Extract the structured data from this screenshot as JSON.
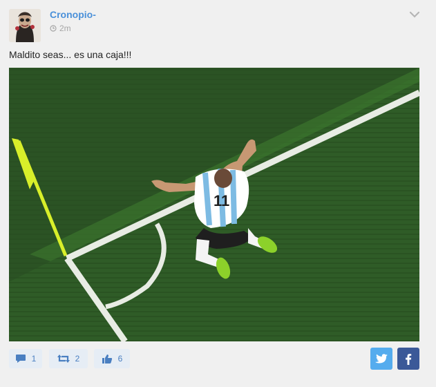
{
  "post": {
    "author": "Cronopio-",
    "time": "2m",
    "text": "Maldito seas... es una caja!!!",
    "player_number": "11"
  },
  "actions": {
    "comments": "1",
    "retweets": "2",
    "likes": "6"
  },
  "share": {
    "twitter_color": "#55acee",
    "facebook_color": "#3b5998"
  },
  "icons": {
    "time": "clock-icon",
    "menu": "chevron-down-icon",
    "comment": "comment-icon",
    "retweet": "retweet-icon",
    "like": "thumbs-up-icon",
    "twitter": "twitter-icon",
    "facebook": "facebook-icon"
  }
}
